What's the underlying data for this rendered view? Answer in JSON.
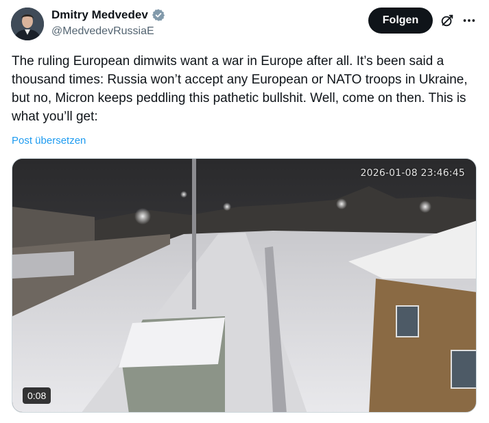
{
  "author": {
    "display_name": "Dmitry Medvedev",
    "handle": "@MedvedevRussiaE"
  },
  "actions": {
    "follow_label": "Folgen"
  },
  "tweet": {
    "text": "The ruling European dimwits want a war in Europe after all. It’s been said a thousand times: Russia won’t accept any European or NATO troops in Ukraine, but no, Micron keeps peddling this pathetic bullshit. Well, come on then. This is what you’ll get:",
    "translate_label": "Post übersetzen"
  },
  "media": {
    "camera_timestamp": "2026-01-08 23:46:45",
    "duration": "0:08"
  },
  "icons": {
    "verified": "verified-badge-icon",
    "grok": "grok-icon",
    "more": "more-icon"
  },
  "colors": {
    "link": "#1d9bf0",
    "follow_bg": "#0f1419",
    "secondary_text": "#536471"
  }
}
